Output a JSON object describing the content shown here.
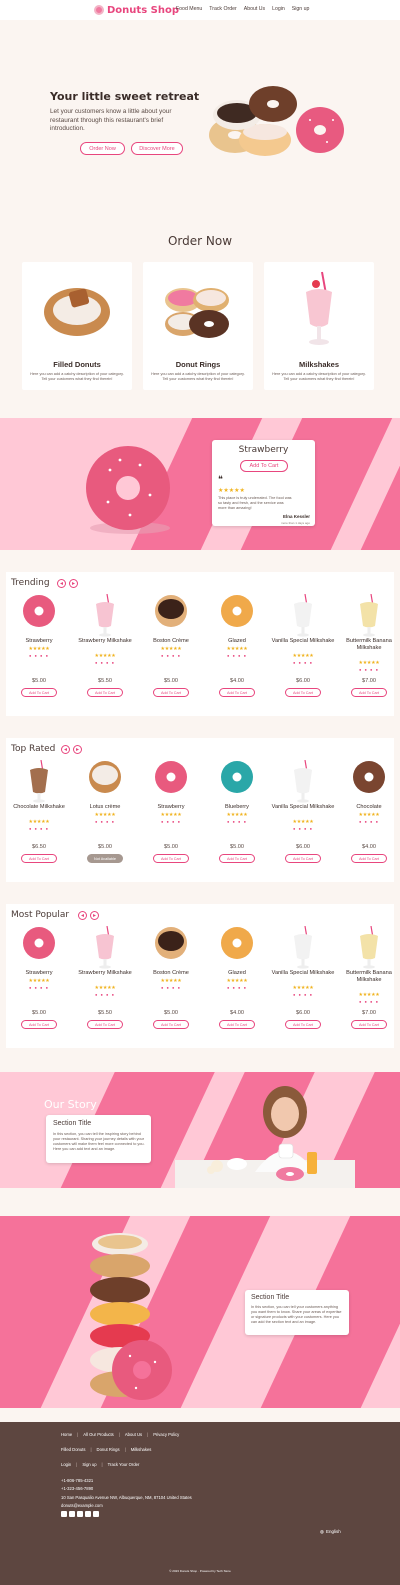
{
  "header": {
    "brand": "Donuts Shop",
    "nav": [
      "Food Menu",
      "Track Order",
      "About Us",
      "Login",
      "Sign up"
    ]
  },
  "hero": {
    "title": "Your little sweet retreat",
    "description": "Let your customers know a little about your restaurant through this restaurant's brief introduction.",
    "order_button": "Order Now",
    "discover_button": "Discover More"
  },
  "order_now": {
    "title": "Order Now",
    "categories": [
      {
        "name": "Filled Donuts",
        "desc": "Here you can add a catchy description of your category. Tell your customers what they find therein!"
      },
      {
        "name": "Donut Rings",
        "desc": "Here you can add a catchy description of your category. Tell your customers what they find therein!"
      },
      {
        "name": "Milkshakes",
        "desc": "Here you can add a catchy description of your category. Tell your customers what they find therein!"
      }
    ]
  },
  "featured": {
    "name": "Strawberry",
    "button": "Add To Cart",
    "rating": 5,
    "stars": "★★★★★",
    "quote_mark": "❝",
    "review": "This place is truly underrated. The food was so tasty and fresh, and the service was more than amazing!",
    "author": "Elna Kessler",
    "author_note": "more than 1 days ago"
  },
  "trending": {
    "title": "Trending",
    "items": [
      {
        "name": "Strawberry",
        "price": "$5.00",
        "button": "Add To Cart",
        "stars": "★★★★★",
        "tags": "● ● ● ●"
      },
      {
        "name": "Strawberry Milkshake",
        "price": "$5.50",
        "button": "Add To Cart",
        "stars": "★★★★★",
        "tags": "● ● ● ●"
      },
      {
        "name": "Boston Crème",
        "price": "$5.00",
        "button": "Add To Cart",
        "stars": "★★★★★",
        "tags": "● ● ● ●"
      },
      {
        "name": "Glazed",
        "price": "$4.00",
        "button": "Add To Cart",
        "stars": "★★★★★",
        "tags": "● ● ● ●"
      },
      {
        "name": "Vanilla Special Milkshake",
        "price": "$6.00",
        "button": "Add To Cart",
        "stars": "★★★★★",
        "tags": "● ● ● ●"
      },
      {
        "name": "Buttermilk Banana Milkshake",
        "price": "$7.00",
        "button": "Add To Cart",
        "stars": "★★★★★",
        "tags": "● ● ● ●"
      }
    ]
  },
  "top_rated": {
    "title": "Top Rated",
    "items": [
      {
        "name": "Chocolate Milkshake",
        "price": "$6.50",
        "button": "Add To Cart",
        "stars": "★★★★★",
        "tags": "● ● ● ●"
      },
      {
        "name": "Lotus crème",
        "price": "$5.00",
        "button": "Not Available",
        "stars": "★★★★★",
        "tags": "● ● ● ●"
      },
      {
        "name": "Strawberry",
        "price": "$5.00",
        "button": "Add To Cart",
        "stars": "★★★★★",
        "tags": "● ● ● ●"
      },
      {
        "name": "Blueberry",
        "price": "$5.00",
        "button": "Add To Cart",
        "stars": "★★★★★",
        "tags": "● ● ● ●"
      },
      {
        "name": "Vanilla Special Milkshake",
        "price": "$6.00",
        "button": "Add To Cart",
        "stars": "★★★★★",
        "tags": "● ● ● ●"
      },
      {
        "name": "Chocolate",
        "price": "$4.00",
        "button": "Add To Cart",
        "stars": "★★★★★",
        "tags": "● ● ● ●"
      }
    ]
  },
  "most_popular": {
    "title": "Most Popular",
    "items": [
      {
        "name": "Strawberry",
        "price": "$5.00",
        "button": "Add To Cart",
        "stars": "★★★★★",
        "tags": "● ● ● ●"
      },
      {
        "name": "Strawberry Milkshake",
        "price": "$5.50",
        "button": "Add To Cart",
        "stars": "★★★★★",
        "tags": "● ● ● ●"
      },
      {
        "name": "Boston Crème",
        "price": "$5.00",
        "button": "Add To Cart",
        "stars": "★★★★★",
        "tags": "● ● ● ●"
      },
      {
        "name": "Glazed",
        "price": "$4.00",
        "button": "Add To Cart",
        "stars": "★★★★★",
        "tags": "● ● ● ●"
      },
      {
        "name": "Vanilla Special Milkshake",
        "price": "$6.00",
        "button": "Add To Cart",
        "stars": "★★★★★",
        "tags": "● ● ● ●"
      },
      {
        "name": "Buttermilk Banana Milkshake",
        "price": "$7.00",
        "button": "Add To Cart",
        "stars": "★★★★★",
        "tags": "● ● ● ●"
      }
    ]
  },
  "our_story": {
    "title": "Our Story",
    "section_title": "Section Title",
    "text": "In this section, you can tell the inspiring story behind your restaurant. Sharing your journey details with your customers will make them feel more connected to you. Here you can add text and an image."
  },
  "section2": {
    "section_title": "Section Title",
    "text": "In this section, you can tell your customers anything you want them to know. Share your areas of expertise or signature products with your customers. Here you can add the section text and an image."
  },
  "footer": {
    "links1": [
      "Home",
      "All Our Products",
      "About Us",
      "Privacy Policy"
    ],
    "links2": [
      "Filled Donuts",
      "Donut Rings",
      "Milkshakes"
    ],
    "links3": [
      "Login",
      "Sign up",
      "Track Your Order"
    ],
    "phone1": "+1-806-785-4321",
    "phone2": "+1-323-456-7890",
    "address": "10 San Pasqualio Avenue NW, Albuquerque, NM, 87104 United States",
    "email": "donuts@example.com",
    "language": "English",
    "copyright": "© 2023 Donuts Shop · Powered by Tech Store"
  },
  "colors": {
    "accent": "#e8467e",
    "pink_light": "#ffc8d6",
    "pink_dark": "#f5729a",
    "footer": "#5d4640",
    "bg": "#fbf5f1"
  }
}
